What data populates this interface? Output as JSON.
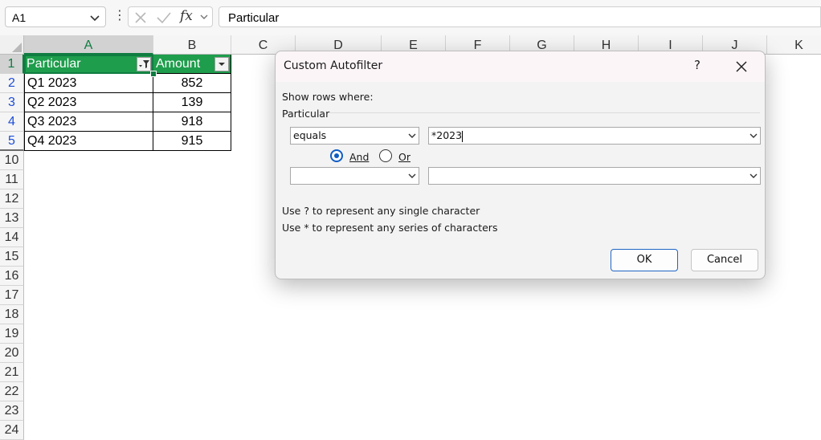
{
  "formula_bar": {
    "name_box": "A1",
    "fx_label": "fx",
    "formula_value": "Particular"
  },
  "columns": [
    "A",
    "B",
    "C",
    "D",
    "E",
    "F",
    "G",
    "H",
    "I",
    "J",
    "K"
  ],
  "rows": [
    "1",
    "2",
    "3",
    "4",
    "5",
    "10",
    "11",
    "12",
    "13",
    "14",
    "15",
    "16",
    "17",
    "18",
    "19",
    "20",
    "21",
    "22",
    "23",
    "24"
  ],
  "table": {
    "headers": [
      "Particular",
      "Amount"
    ],
    "rows": [
      [
        "Q1 2023",
        "852"
      ],
      [
        "Q2 2023",
        "139"
      ],
      [
        "Q3 2023",
        "918"
      ],
      [
        "Q4 2023",
        "915"
      ]
    ]
  },
  "dialog": {
    "title": "Custom Autofilter",
    "help": "?",
    "show_rows_label": "Show rows where:",
    "field_label": "Particular",
    "criteria1_operator": "equals",
    "criteria1_value": "*2023",
    "and_label": "And",
    "or_label": "Or",
    "and_selected": true,
    "criteria2_operator": "",
    "criteria2_value": "",
    "hint_single": "Use ? to represent any single character",
    "hint_series": "Use * to represent any series of characters",
    "ok_label": "OK",
    "cancel_label": "Cancel"
  },
  "colors": {
    "accent_green": "#107c41",
    "header_fill": "#1e9d4c",
    "filtered_row_number": "#1f4ed8",
    "dialog_primary": "#0f5cc4"
  }
}
